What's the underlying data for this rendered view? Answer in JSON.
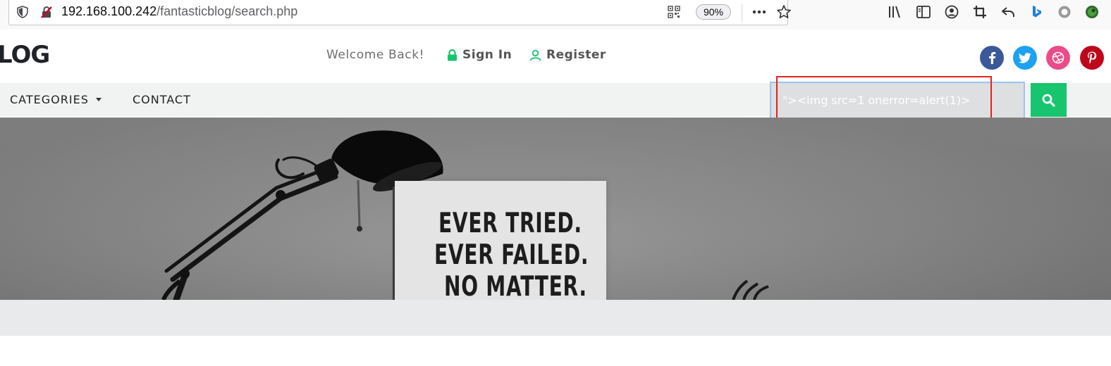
{
  "browser": {
    "url_host": "192.168.100.242",
    "url_path": "/fantasticblog/search.php",
    "zoom": "90%"
  },
  "site": {
    "logo": "LOG",
    "welcome": "Welcome Back!",
    "sign_in": "Sign In",
    "register": "Register",
    "social": [
      "facebook-icon",
      "twitter-icon",
      "dribbble-icon",
      "pinterest-icon"
    ],
    "social_colors": {
      "facebook": "#3b5998",
      "twitter": "#1da1f2",
      "dribbble": "#ea4c89",
      "pinterest": "#bd081c"
    }
  },
  "nav": {
    "categories": "CATEGORIES",
    "contact": "CONTACT"
  },
  "search": {
    "value": "\"><img src=1 onerror=alert(1)>"
  },
  "hero": {
    "poster_lines": [
      "EVER TRIED.",
      "EVER FAILED.",
      "NO MATTER."
    ]
  },
  "colors": {
    "accent_green": "#16c56e",
    "highlight_red": "#e2231a"
  }
}
